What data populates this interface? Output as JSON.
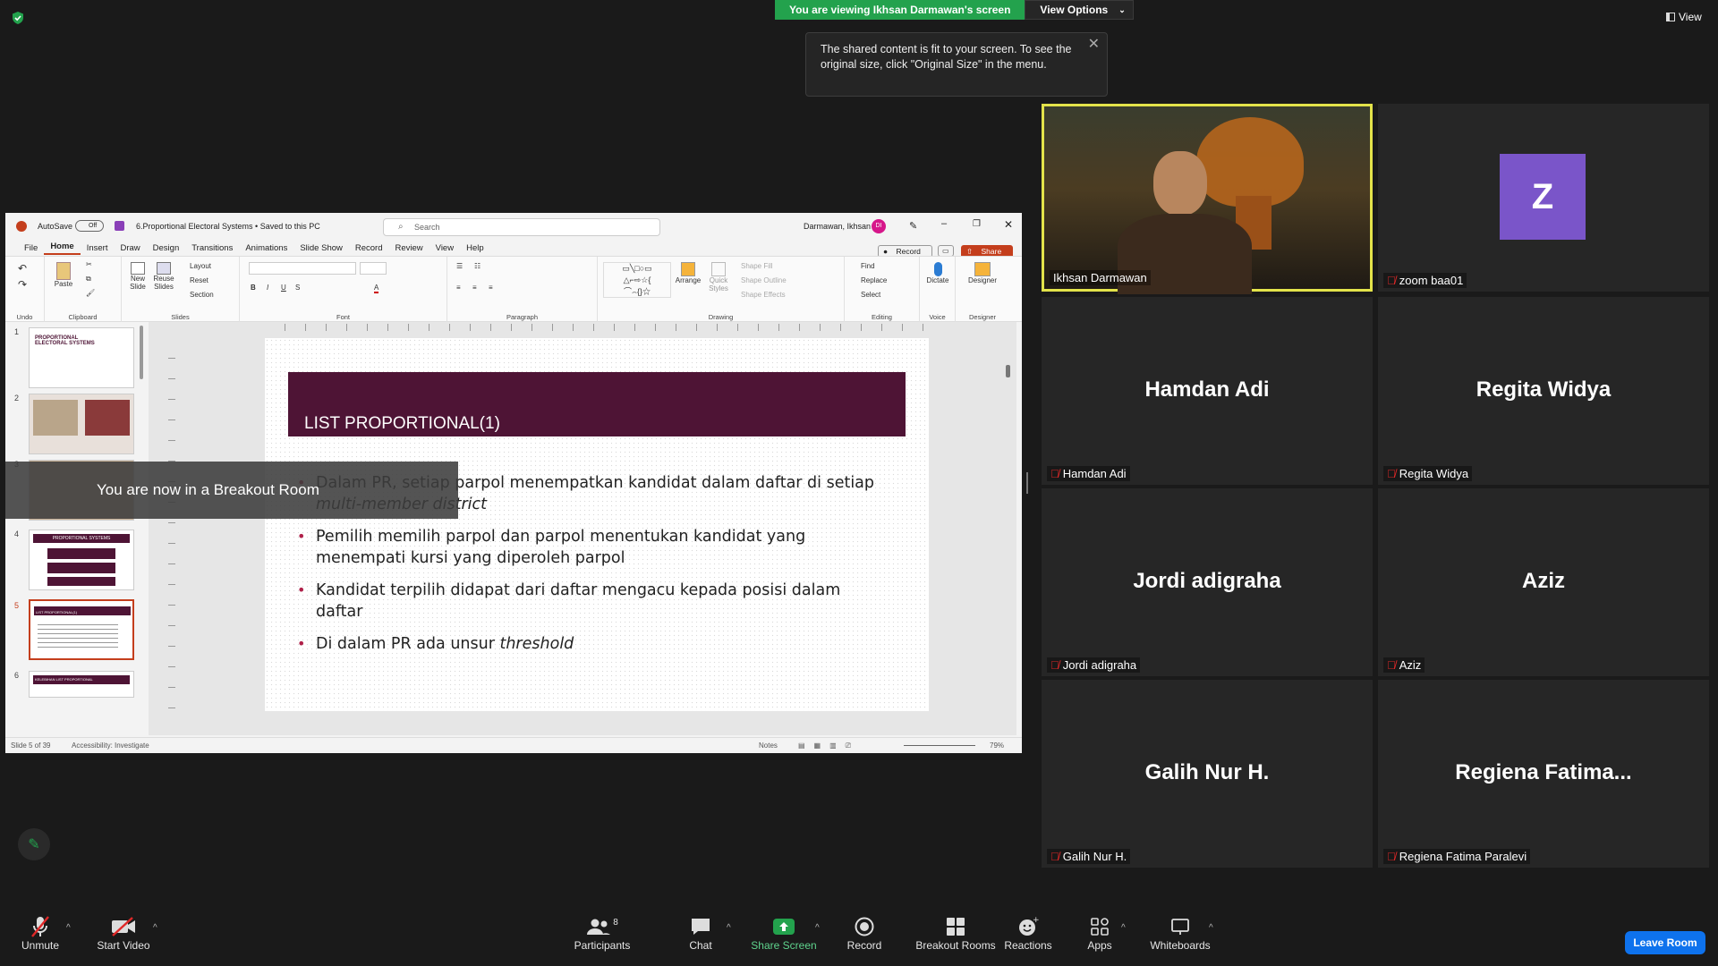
{
  "banner": {
    "viewing": "You are viewing Ikhsan Darmawan's screen",
    "view_options": "View Options"
  },
  "tooltip": {
    "text": "The shared content is fit to your screen. To see the original size, click \"Original Size\" in the menu."
  },
  "top_right": {
    "view_label": "View"
  },
  "ppt": {
    "autosave": "AutoSave",
    "autosave_state": "Off",
    "doc_title": "6.Proportional Electoral Systems • Saved to this PC",
    "search_placeholder": "Search",
    "user": "Darmawan, Ikhsan",
    "user_initials": "DI",
    "menu": [
      "File",
      "Home",
      "Insert",
      "Draw",
      "Design",
      "Transitions",
      "Animations",
      "Slide Show",
      "Record",
      "Review",
      "View",
      "Help"
    ],
    "record_btn": "Record",
    "share_btn": "Share",
    "ribbon": {
      "undo": "Undo",
      "clipboard": "Clipboard",
      "paste": "Paste",
      "new_slide": "New Slide",
      "reuse_slides": "Reuse Slides",
      "layout": "Layout",
      "reset": "Reset",
      "section": "Section",
      "slides": "Slides",
      "font": "Font",
      "paragraph": "Paragraph",
      "arrange": "Arrange",
      "quick_styles": "Quick Styles",
      "shape_fill": "Shape Fill",
      "shape_outline": "Shape Outline",
      "shape_effects": "Shape Effects",
      "drawing": "Drawing",
      "find": "Find",
      "replace": "Replace",
      "select": "Select",
      "editing": "Editing",
      "dictate": "Dictate",
      "voice": "Voice",
      "designer": "Designer",
      "designer_group": "Designer"
    },
    "thumbs": [
      {
        "num": "1",
        "title": "PROPORTIONAL ELECTORAL SYSTEMS"
      },
      {
        "num": "2",
        "title": ""
      },
      {
        "num": "3",
        "title": ""
      },
      {
        "num": "4",
        "title": "PROPORTIONAL SYSTEMS"
      },
      {
        "num": "5",
        "title": "LIST PROPORTIONAL(1)"
      },
      {
        "num": "6",
        "title": "KELEBIHAN LIST PROPORTIONAL"
      }
    ],
    "slide": {
      "title": "LIST PROPORTIONAL(1)",
      "bullets": [
        {
          "text": "Dalam PR, setiap parpol menempatkan kandidat dalam daftar di setiap ",
          "em": "multi-member district"
        },
        {
          "text": "Pemilih memilih parpol dan parpol menentukan kandidat yang menempati kursi yang diperoleh parpol",
          "em": ""
        },
        {
          "text": "Kandidat terpilih didapat dari daftar mengacu kepada posisi dalam daftar",
          "em": ""
        },
        {
          "text": "Di dalam PR ada unsur ",
          "em": "threshold"
        }
      ]
    },
    "status": {
      "slide_of": "Slide 5 of 39",
      "accessibility": "Accessibility: Investigate",
      "notes": "Notes",
      "zoom": "79%"
    }
  },
  "breakout_msg": "You are now in a Breakout Room",
  "participants": [
    {
      "name": "Ikhsan Darmawan",
      "big": "",
      "video": true
    },
    {
      "name": "zoom baa01",
      "big": "Z",
      "avatar_color": "#7a55c9"
    },
    {
      "name": "Hamdan Adi",
      "big": "Hamdan Adi"
    },
    {
      "name": "Regita Widya",
      "big": "Regita Widya"
    },
    {
      "name": "Jordi adigraha",
      "big": "Jordi adigraha"
    },
    {
      "name": "Aziz",
      "big": "Aziz"
    },
    {
      "name": "Galih Nur H.",
      "big": "Galih Nur H."
    },
    {
      "name": "Regiena Fatima Paralevi",
      "big": "Regiena  Fatima..."
    }
  ],
  "toolbar": {
    "unmute": "Unmute",
    "start_video": "Start Video",
    "participants": "Participants",
    "participants_count": "8",
    "chat": "Chat",
    "share_screen": "Share Screen",
    "record": "Record",
    "breakout_rooms": "Breakout Rooms",
    "reactions": "Reactions",
    "apps": "Apps",
    "whiteboards": "Whiteboards",
    "leave": "Leave Room"
  },
  "colors": {
    "share_green": "#23a24d",
    "slide_header": "#4e1435",
    "leave_blue": "#0e72ed",
    "speaker_border": "#e3e34a",
    "mute_red": "#e02828"
  }
}
